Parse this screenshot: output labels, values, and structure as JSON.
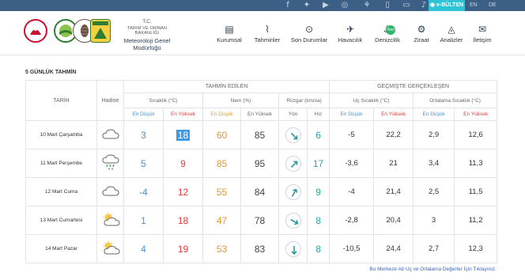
{
  "topbar": {
    "bulten_label": "e-BÜLTEN",
    "lang_en": "EN",
    "lang_de": "DE",
    "icons": [
      "facebook-icon",
      "twitter-icon",
      "youtube-icon",
      "instagram-icon",
      "tree-icon",
      "tablet-icon",
      "monitor-icon",
      "microphone-icon",
      "eye-icon"
    ]
  },
  "header": {
    "org_tc": "T.C.",
    "org_ministry": "TARIM VE ORMAN BAKANLIĞI",
    "org_name": "Meteoroloji Genel Müdürlüğü",
    "nav": [
      {
        "label": "Kurumsal",
        "icon": "building-icon"
      },
      {
        "label": "Tahminler",
        "icon": "chart-icon"
      },
      {
        "label": "Son Durumlar",
        "icon": "check-circle-icon"
      },
      {
        "label": "Havacılık",
        "icon": "plane-icon"
      },
      {
        "label": "Denizcilik",
        "icon": "ship-icon"
      },
      {
        "label": "Ziraat",
        "icon": "tractor-icon"
      },
      {
        "label": "Analizler",
        "icon": "drop-icon"
      },
      {
        "label": "İletişim",
        "icon": "envelope-icon"
      }
    ],
    "badge": "Yeni"
  },
  "forecast": {
    "title": "5 GÜNLÜK TAHMİN",
    "group_predicted": "TAHMİN EDİLEN",
    "group_past": "GEÇMİŞTE GERÇEKLEŞEN",
    "col_date": "TARİH",
    "col_event": "Hadise",
    "col_temp": "Sıcaklık (°C)",
    "col_hum": "Nem (%)",
    "col_wind": "Rüzgar (km/sa)",
    "col_extreme": "Uç Sıcaklık (°C)",
    "col_avg": "Ortalama Sıcaklık (°C)",
    "sub_low": "En Düşük",
    "sub_high": "En Yüksek",
    "sub_dir": "Yön",
    "sub_speed": "Hız",
    "rows": [
      {
        "date": "10 Mart Çarşamba",
        "icon": "cloudy-icon",
        "tmin": "3",
        "tmax": "18",
        "hmin": "60",
        "hmax": "85",
        "wdir": 315,
        "wspd": "6",
        "pmin": "-5",
        "pmax": "22,2",
        "amin": "2,9",
        "amax": "12,6"
      },
      {
        "date": "11 Mart Perşembe",
        "icon": "rain-cloud-icon",
        "tmin": "5",
        "tmax": "9",
        "hmin": "85",
        "hmax": "95",
        "wdir": 225,
        "wspd": "17",
        "pmin": "-3,6",
        "pmax": "21",
        "amin": "3,4",
        "amax": "11,3"
      },
      {
        "date": "12 Mart Cuma",
        "icon": "cloudy-icon",
        "tmin": "-4",
        "tmax": "12",
        "hmin": "55",
        "hmax": "84",
        "wdir": 210,
        "wspd": "9",
        "pmin": "-4",
        "pmax": "21,4",
        "amin": "2,5",
        "amax": "11,5"
      },
      {
        "date": "13 Mart Cumartesi",
        "icon": "partly-cloudy-icon",
        "tmin": "1",
        "tmax": "18",
        "hmin": "47",
        "hmax": "78",
        "wdir": 300,
        "wspd": "8",
        "pmin": "-2,8",
        "pmax": "20,4",
        "amin": "3",
        "amax": "11,2"
      },
      {
        "date": "14 Mart Pazar",
        "icon": "partly-cloudy-icon",
        "tmin": "4",
        "tmax": "19",
        "hmin": "53",
        "hmax": "83",
        "wdir": 0,
        "wspd": "8",
        "pmin": "-10,5",
        "pmax": "24,4",
        "amin": "2,7",
        "amax": "12,3"
      }
    ],
    "footnote": "Bu Merkeze Ait Uç ve Ortalama Değerler İçin Tıklayınız."
  },
  "colors": {
    "topbar": "#3b5f85",
    "accent": "#2ec4d8",
    "low": "#4a90d0",
    "high": "#e23b3b",
    "humidity_low": "#e49a2a",
    "wind_speed": "#27a6a6",
    "link": "#3b66b7"
  }
}
